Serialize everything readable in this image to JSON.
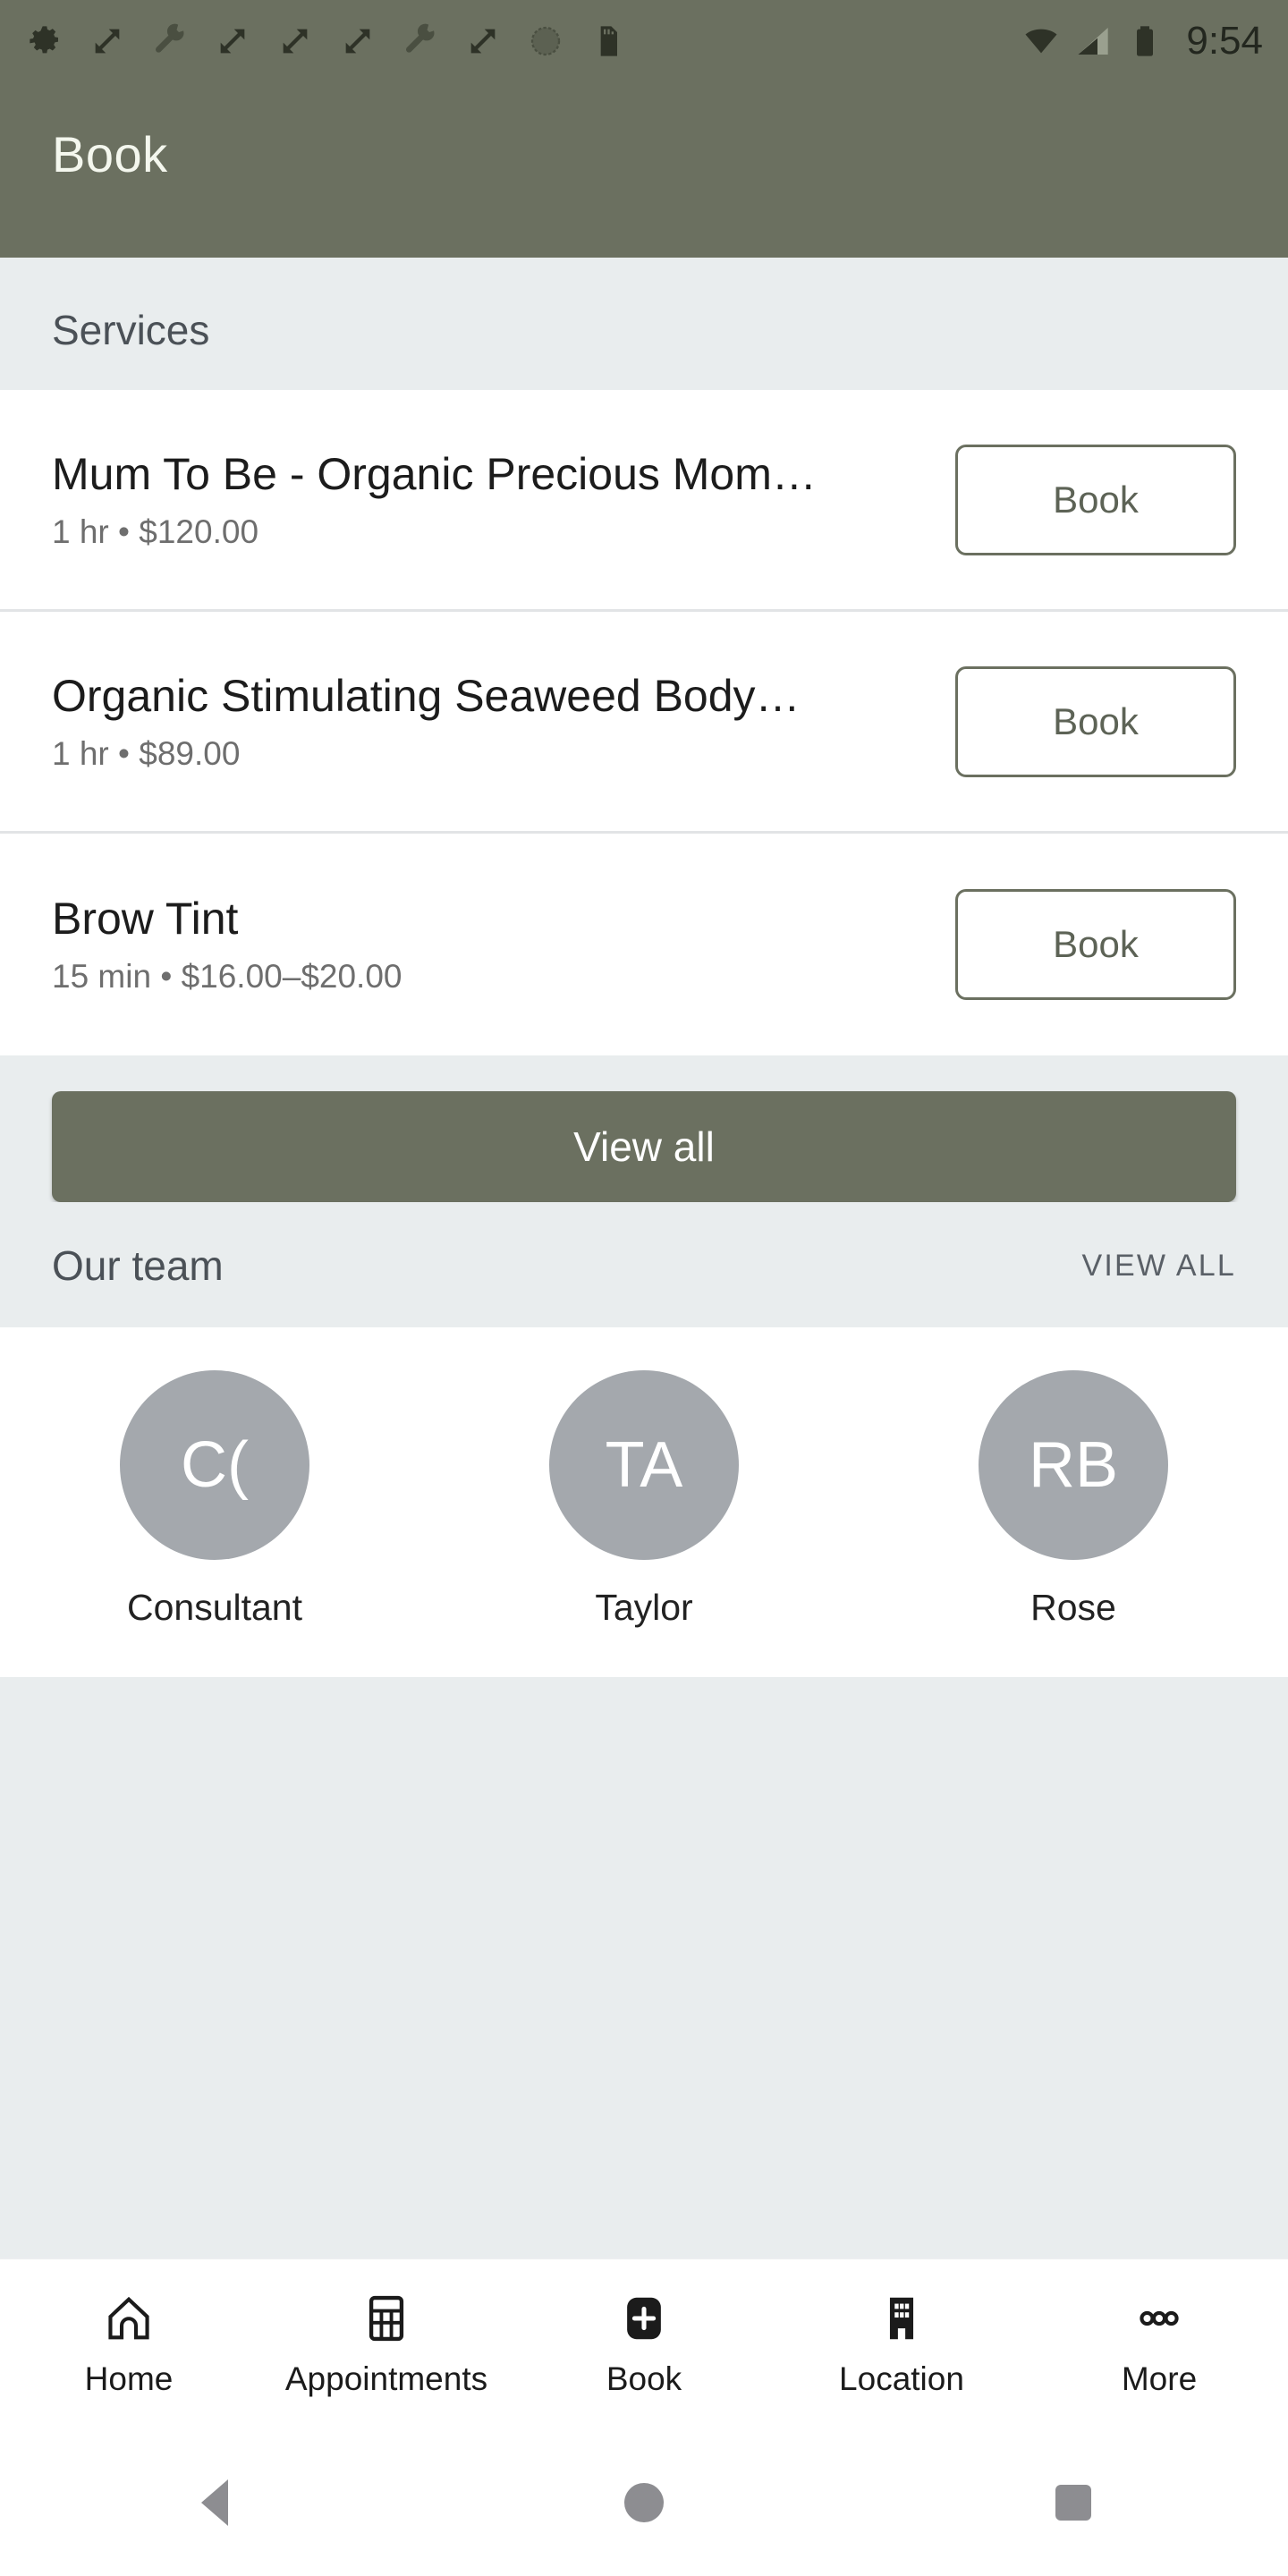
{
  "status_bar": {
    "time": "9:54",
    "left_icons": [
      "gear-icon",
      "resize-icon",
      "wrench-icon",
      "resize-icon",
      "resize-icon",
      "resize-icon",
      "wrench-icon",
      "resize-icon",
      "dial-icon",
      "sdcard-icon"
    ],
    "right_icons": [
      "wifi-icon",
      "cell-signal-icon",
      "battery-icon"
    ]
  },
  "app_bar": {
    "title": "Book"
  },
  "services_section": {
    "title": "Services",
    "items": [
      {
        "name": "Mum To Be - Organic Precious Mom…",
        "meta": "1 hr  •  $120.00",
        "button": "Book"
      },
      {
        "name": "Organic Stimulating Seaweed Body…",
        "meta": "1 hr  •  $89.00",
        "button": "Book"
      },
      {
        "name": "Brow Tint",
        "meta": "15 min • $16.00–$20.00",
        "button": "Book"
      }
    ],
    "view_all_button": "View all"
  },
  "team_section": {
    "title": "Our team",
    "view_all_link": "VIEW ALL",
    "members": [
      {
        "initials": "C(",
        "name": "Consultant"
      },
      {
        "initials": "TA",
        "name": "Taylor"
      },
      {
        "initials": "RB",
        "name": "Rose"
      }
    ]
  },
  "bottom_nav": {
    "items": [
      {
        "label": "Home",
        "icon": "home-icon"
      },
      {
        "label": "Appointments",
        "icon": "calendar-icon"
      },
      {
        "label": "Book",
        "icon": "book-plus-icon"
      },
      {
        "label": "Location",
        "icon": "building-icon"
      },
      {
        "label": "More",
        "icon": "more-dots-icon"
      }
    ]
  },
  "android_nav": {
    "back": "back-button",
    "home": "home-button",
    "recents": "recents-button"
  },
  "colors": {
    "brand_green": "#6b7060",
    "page_background": "#e9edee",
    "card_background": "#ffffff",
    "avatar_grey": "#a4a8ad"
  }
}
